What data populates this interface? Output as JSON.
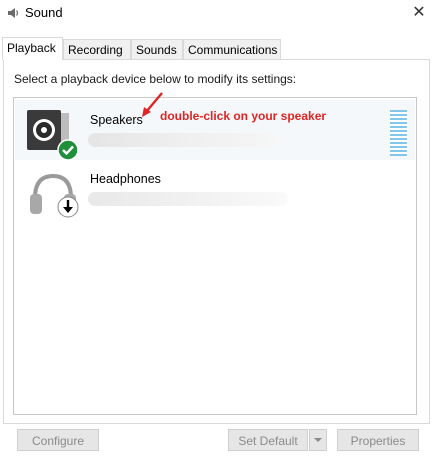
{
  "window": {
    "title": "Sound",
    "close_glyph": "✕"
  },
  "tabs": [
    {
      "label": "Playback",
      "active": true
    },
    {
      "label": "Recording",
      "active": false
    },
    {
      "label": "Sounds",
      "active": false
    },
    {
      "label": "Communications",
      "active": false
    }
  ],
  "instructions": "Select a playback device below to modify its settings:",
  "devices": [
    {
      "name": "Speakers",
      "icon": "speaker-icon",
      "status_icon": "default-checkmark-icon",
      "selected": true
    },
    {
      "name": "Headphones",
      "icon": "headphones-icon",
      "status_icon": "down-arrow-icon",
      "selected": false
    }
  ],
  "annotation": "double-click on your speaker",
  "buttons": {
    "configure": "Configure",
    "set_default": "Set Default",
    "properties": "Properties"
  },
  "colors": {
    "annotation": "#e02424",
    "level_meter": "#84c6ea",
    "check_green": "#1e8f3a"
  }
}
